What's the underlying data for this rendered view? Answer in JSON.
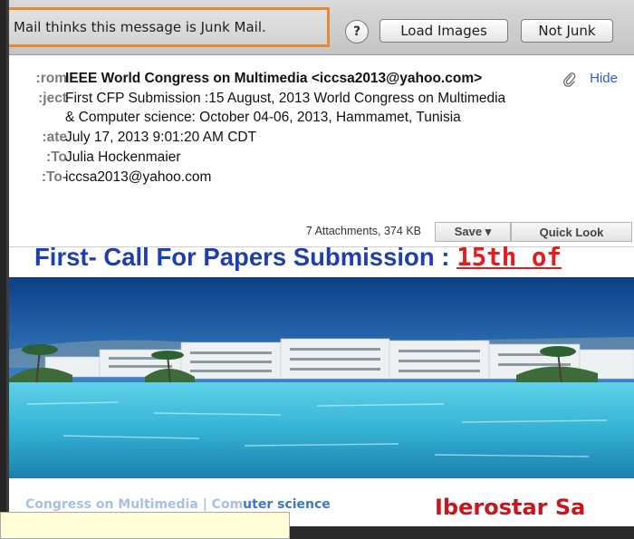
{
  "junk_bar": {
    "message": "Mail thinks this message is Junk Mail.",
    "help_label": "?",
    "load_images_label": "Load Images",
    "not_junk_label": "Not Junk"
  },
  "headers": {
    "from_label": "rom:",
    "from_value": "IEEE World Congress on Multimedia <iccsa2013@yahoo.com>",
    "hide_label": "Hide",
    "subject_label": "ject:",
    "subject_line1": "First CFP Submission :15  August, 2013 World Congress on Multimedia",
    "subject_line2": "& Computer science: October 04-06, 2013, Hammamet, Tunisia",
    "date_label": "ate:",
    "date_value": "July 17, 2013 9:01:20 AM CDT",
    "to_label": "To:",
    "to_value": "Julia Hockenmaier",
    "replyto_label": "-To:",
    "replyto_value": "iccsa2013@yahoo.com"
  },
  "attachments": {
    "info": "7 Attachments, 374 KB",
    "save_label": "Save ▾",
    "quick_look_label": "Quick Look"
  },
  "body": {
    "title_main": "First- Call For Papers Submission : ",
    "title_date": "15th of",
    "bottom_left_faded": "Congress on Multimedia | Com",
    "bottom_left": "uter science",
    "bottom_right": "Iberostar Sa"
  },
  "colors": {
    "junk_outline": "#e2893a",
    "title_blue": "#1f3fae",
    "title_red": "#e21d1d",
    "link_blue": "#2a5bd7"
  },
  "icons": [
    "paperclip-icon",
    "help-icon",
    "dropdown-arrow-icon"
  ]
}
